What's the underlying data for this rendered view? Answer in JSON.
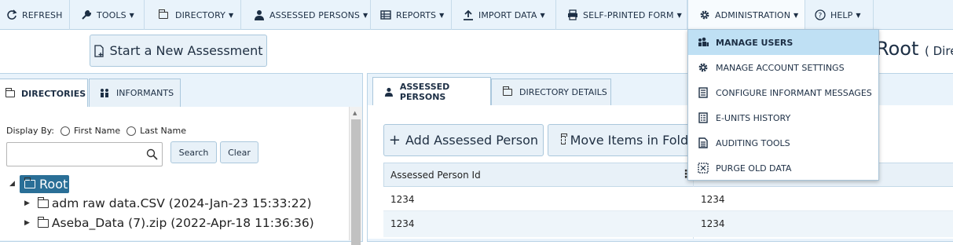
{
  "menu": {
    "refresh": "REFRESH",
    "tools": "TOOLS",
    "directory": "DIRECTORY",
    "assessed_persons": "ASSESSED PERSONS",
    "reports": "REPORTS",
    "import_data": "IMPORT DATA",
    "self_printed_form": "SELF-PRINTED FORM",
    "administration": "ADMINISTRATION",
    "help": "HELP"
  },
  "admin_menu": {
    "items": [
      {
        "label": "MANAGE USERS",
        "icon": "users-icon"
      },
      {
        "label": "MANAGE ACCOUNT SETTINGS",
        "icon": "gear-icon"
      },
      {
        "label": "CONFIGURE INFORMANT MESSAGES",
        "icon": "document-icon"
      },
      {
        "label": "E-UNITS HISTORY",
        "icon": "list-icon"
      },
      {
        "label": "AUDITING TOOLS",
        "icon": "document-icon"
      },
      {
        "label": "PURGE OLD DATA",
        "icon": "purge-icon"
      }
    ]
  },
  "start_assessment": "Start a New Assessment",
  "page_title": {
    "name": "Root",
    "suffix": "( Dire"
  },
  "left_tabs": {
    "directories": "DIRECTORIES",
    "informants": "INFORMANTS"
  },
  "display_by": {
    "label": "Display By:",
    "first": "First Name",
    "last": "Last Name"
  },
  "search": {
    "placeholder": "",
    "search_btn": "Search",
    "clear_btn": "Clear"
  },
  "tree": {
    "root": "Root",
    "children": [
      "adm raw data.CSV (2024-Jan-23 15:33:22)",
      "Aseba_Data (7).zip (2022-Apr-18 11:36:36)"
    ]
  },
  "right_tabs": {
    "assessed_persons": "ASSESSED PERSONS",
    "directory_details": "DIRECTORY DETAILS"
  },
  "actions": {
    "add": "Add Assessed Person",
    "move": "Move Items in Folde"
  },
  "table": {
    "col1": "Assessed Person Id",
    "rows": [
      [
        "1234",
        "1234"
      ],
      [
        "1234",
        "1234"
      ]
    ]
  },
  "colors": {
    "accent": "#2a6f97",
    "highlight": "#bfe0f4",
    "bar": "#e9f3fb"
  }
}
